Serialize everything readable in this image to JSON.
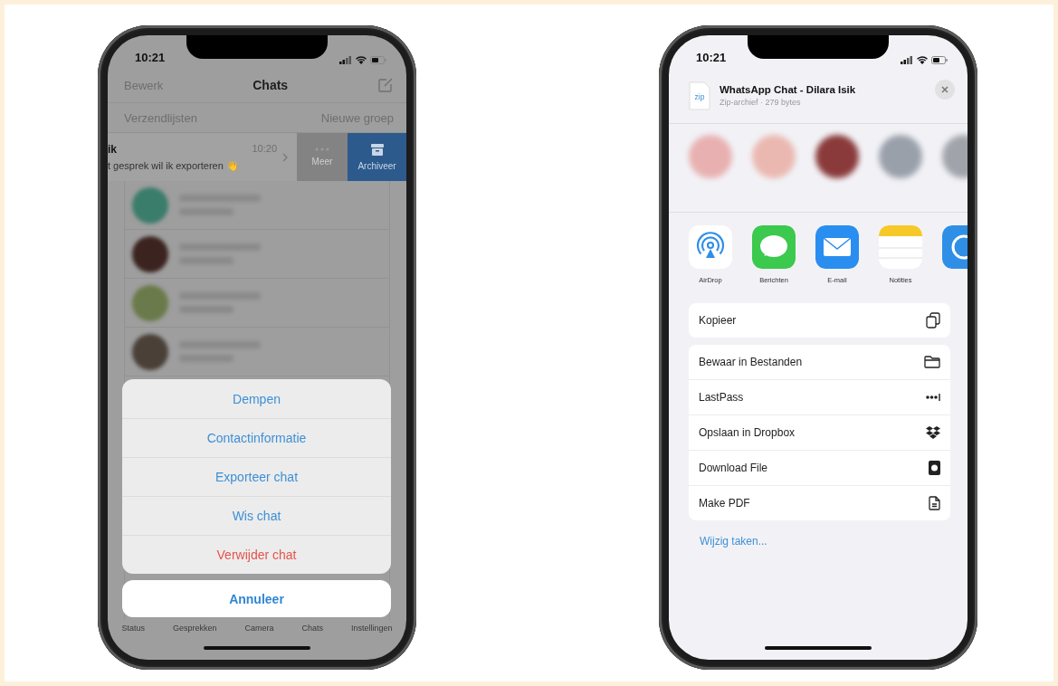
{
  "left_phone": {
    "status_bar": {
      "time": "10:21"
    },
    "nav": {
      "edit": "Bewerk",
      "title": "Chats"
    },
    "links": {
      "broadcast": "Verzendlijsten",
      "new_group": "Nieuwe groep"
    },
    "swiped_chat": {
      "name": "ik",
      "time": "10:20",
      "message": "t gesprek wil ik exporteren 👋",
      "actions": [
        {
          "kind": "more",
          "label": "Meer"
        },
        {
          "kind": "archive",
          "label": "Archiveer"
        }
      ]
    },
    "action_sheet": {
      "items": [
        {
          "label": "Dempen",
          "kind": "default"
        },
        {
          "label": "Contactinformatie",
          "kind": "default"
        },
        {
          "label": "Exporteer chat",
          "kind": "default"
        },
        {
          "label": "Wis chat",
          "kind": "default"
        },
        {
          "label": "Verwijder chat",
          "kind": "destructive"
        }
      ],
      "cancel": "Annuleer"
    },
    "tab_bar": [
      "Status",
      "Gesprekken",
      "Camera",
      "Chats",
      "Instellingen"
    ]
  },
  "right_phone": {
    "status_bar": {
      "time": "10:21"
    },
    "file": {
      "type": "zip",
      "title": "WhatsApp Chat - Dilara Isik",
      "subtitle": "Zip-archief · 279 bytes"
    },
    "apps": [
      {
        "kind": "airdrop",
        "label": "AirDrop"
      },
      {
        "kind": "messages",
        "label": "Berichten"
      },
      {
        "kind": "mail",
        "label": "E-mail"
      },
      {
        "kind": "notes",
        "label": "Notities"
      },
      {
        "kind": "partial"
      }
    ],
    "action_groups": [
      [
        {
          "label": "Kopieer",
          "kind": "copy"
        }
      ],
      [
        {
          "label": "Bewaar in Bestanden",
          "kind": "folder"
        },
        {
          "label": "LastPass",
          "kind": "lastpass"
        },
        {
          "label": "Opslaan in Dropbox",
          "kind": "dropbox"
        },
        {
          "label": "Download File",
          "kind": "download"
        },
        {
          "label": "Make PDF",
          "kind": "pdf"
        }
      ]
    ],
    "edit_link": "Wijzig taken..."
  }
}
